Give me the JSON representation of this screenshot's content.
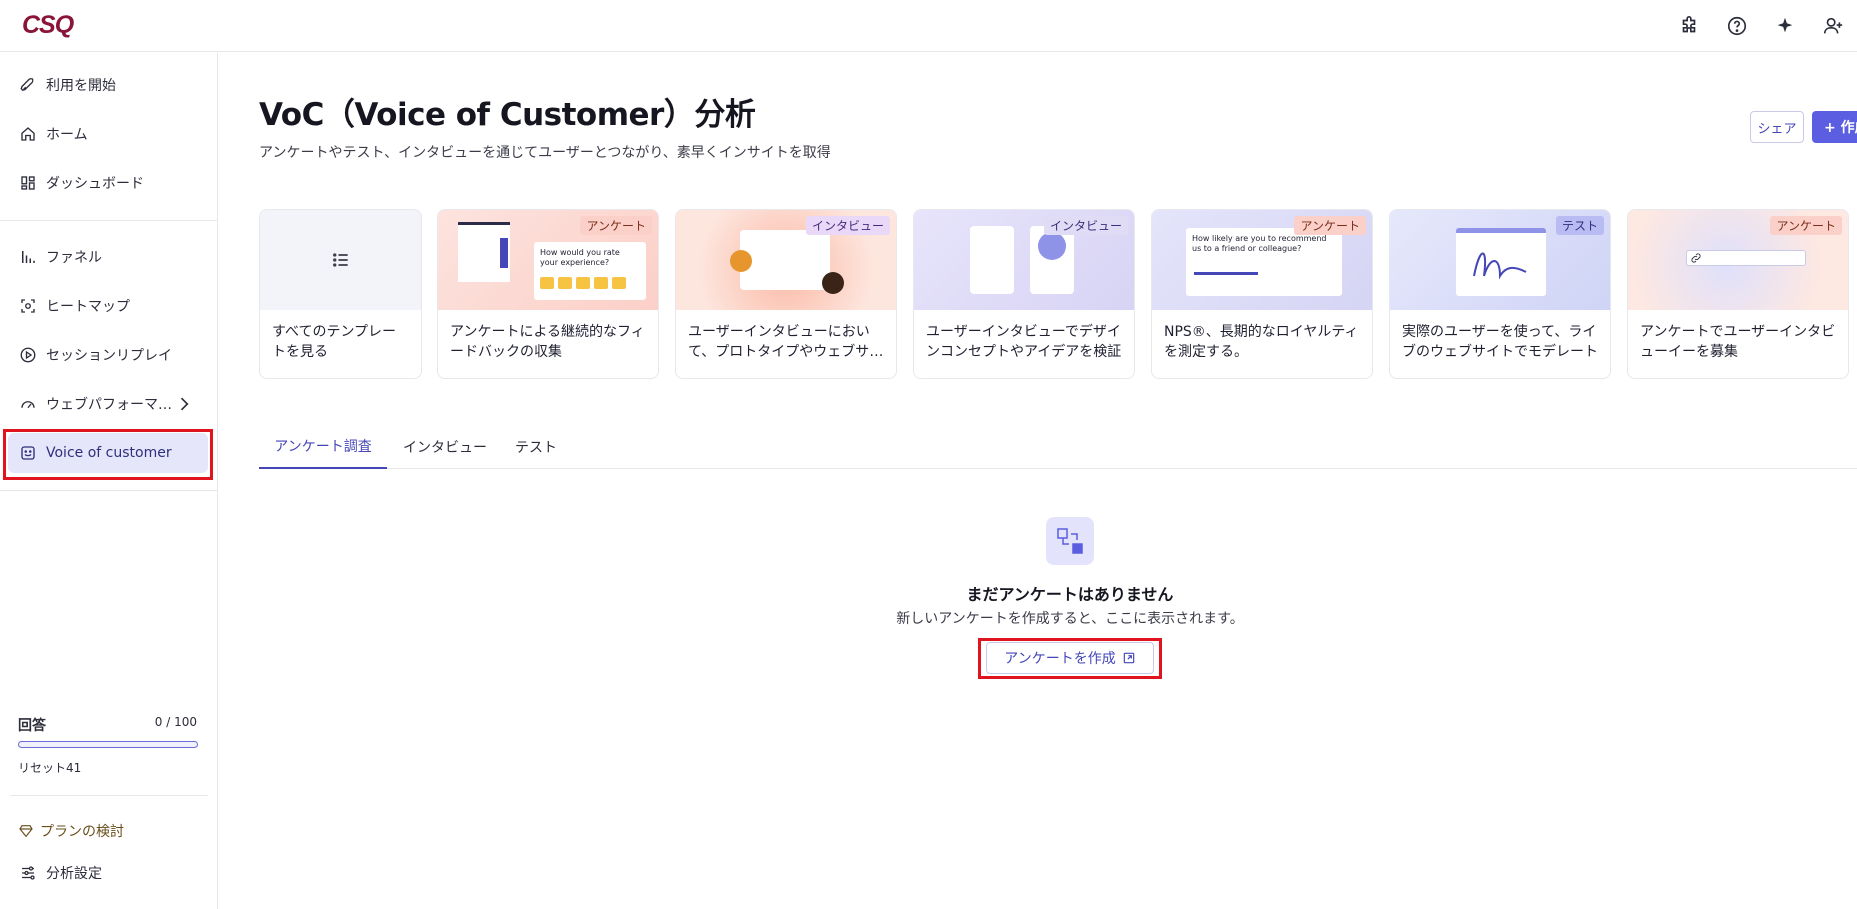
{
  "app": {
    "logo": "CSQ"
  },
  "topbar": {
    "icons": [
      "puzzle-icon",
      "help-icon",
      "sparkle-icon",
      "add-user-icon"
    ]
  },
  "sidebar": {
    "items": [
      {
        "label": "利用を開始",
        "icon": "rocket-icon"
      },
      {
        "label": "ホーム",
        "icon": "home-icon"
      },
      {
        "label": "ダッシュボード",
        "icon": "dashboard-icon"
      },
      {
        "label": "ファネル",
        "icon": "funnel-icon"
      },
      {
        "label": "ヒートマップ",
        "icon": "heatmap-icon"
      },
      {
        "label": "セッションリプレイ",
        "icon": "replay-icon"
      },
      {
        "label": "ウェブパフォーマ…",
        "icon": "gauge-icon"
      },
      {
        "label": "Voice of customer",
        "icon": "voc-icon"
      }
    ],
    "quota": {
      "label": "回答",
      "value": "0 / 100",
      "fraction": 0,
      "reset": "リセット41"
    },
    "plan": "プランの検討",
    "settings": "分析設定"
  },
  "main": {
    "title": "VoC（Voice of Customer）分析",
    "subtitle": "アンケートやテスト、インタビューを通じてユーザーとつながり、素早くインサイトを取得",
    "share_label": "シェア",
    "create_label": "+ 作成",
    "cards": [
      {
        "text": "すべてのテンプレートを見る",
        "tag": ""
      },
      {
        "text": "アンケートによる継続的なフィードバックの収集",
        "tag": "アンケート",
        "mock_q": "How would you rate your experience?"
      },
      {
        "text": "ユーザーインタビューにおいて、プロトタイプやウェブサイトを",
        "tag": "インタビュー"
      },
      {
        "text": "ユーザーインタビューでデザインコンセプトやアイデアを検証",
        "tag": "インタビュー"
      },
      {
        "text": "NPS®、長期的なロイヤルティを測定する。",
        "tag": "アンケート",
        "mock_q": "How likely are you to recommend us to a friend or colleague?"
      },
      {
        "text": "実際のユーザーを使って、ライブのウェブサイトでモデレート",
        "tag": "テスト"
      },
      {
        "text": "アンケートでユーザーインタビューイーを募集",
        "tag": "アンケート"
      }
    ],
    "tabs": [
      "アンケート調査",
      "インタビュー",
      "テスト"
    ],
    "empty": {
      "title": "まだアンケートはありません",
      "desc": "新しいアンケートを作成すると、ここに表示されます。",
      "button": "アンケートを作成"
    }
  },
  "colors": {
    "accent": "#5b5ee0",
    "brand": "#8a1538",
    "highlight": "#e0141e"
  }
}
